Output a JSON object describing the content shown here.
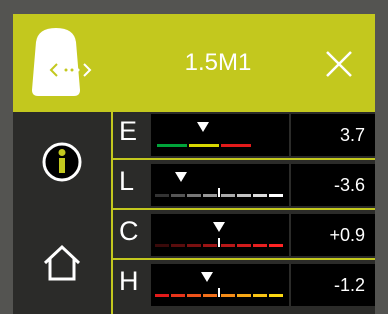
{
  "header": {
    "title": "1.5M1",
    "icons": {
      "device": "hearing-device-icon",
      "close": "close-icon",
      "info": "info-icon",
      "home": "home-icon"
    }
  },
  "rows": [
    {
      "letter": "E",
      "value": "3.7"
    },
    {
      "letter": "L",
      "value": "-3.6"
    },
    {
      "letter": "C",
      "value": "+0.9"
    },
    {
      "letter": "H",
      "value": "-1.2"
    }
  ],
  "colors": {
    "accent": "#c3c81e",
    "panel": "#2b2b29",
    "frame": "#545451"
  }
}
